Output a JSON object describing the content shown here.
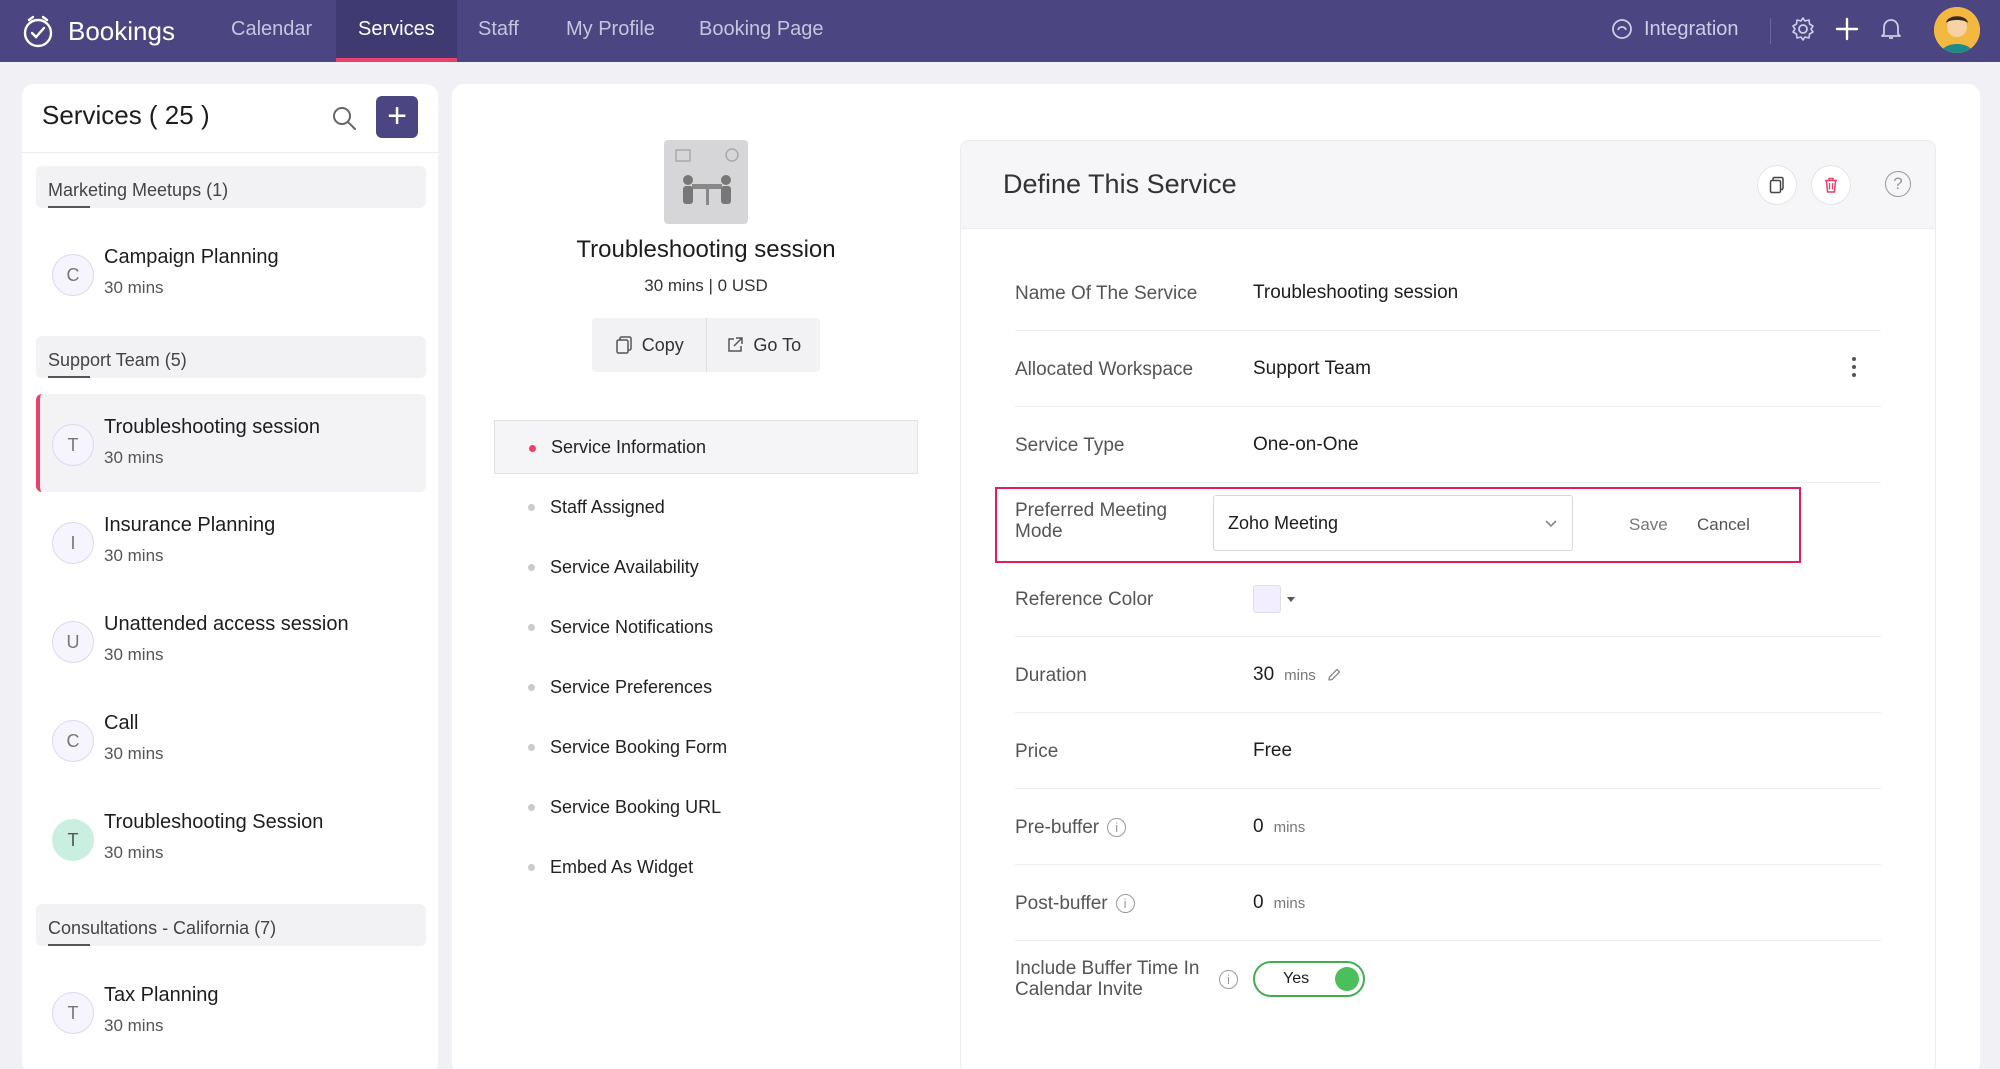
{
  "app": {
    "name": "Bookings"
  },
  "nav": {
    "tabs": [
      {
        "label": "Calendar"
      },
      {
        "label": "Services"
      },
      {
        "label": "Staff"
      },
      {
        "label": "My Profile"
      },
      {
        "label": "Booking Page"
      }
    ],
    "integration_label": "Integration"
  },
  "services_panel": {
    "title": "Services ( 25 )",
    "groups": [
      {
        "name": "Marketing Meetups (1)"
      },
      {
        "name": "Support Team (5)"
      },
      {
        "name": "Consultations - California (7)"
      }
    ],
    "items": [
      {
        "initial": "C",
        "name": "Campaign Planning",
        "duration": "30 mins"
      },
      {
        "initial": "T",
        "name": "Troubleshooting session",
        "duration": "30 mins"
      },
      {
        "initial": "I",
        "name": "Insurance Planning",
        "duration": "30 mins"
      },
      {
        "initial": "U",
        "name": "Unattended access session",
        "duration": "30 mins"
      },
      {
        "initial": "C",
        "name": "Call",
        "duration": "30 mins"
      },
      {
        "initial": "T",
        "name": "Troubleshooting Session",
        "duration": "30 mins"
      },
      {
        "initial": "T",
        "name": "Tax Planning",
        "duration": "30 mins"
      }
    ]
  },
  "service": {
    "title": "Troubleshooting session",
    "meta": "30 mins | 0 USD",
    "copy_label": "Copy",
    "goto_label": "Go To",
    "menu": [
      {
        "label": "Service Information"
      },
      {
        "label": "Staff Assigned"
      },
      {
        "label": "Service Availability"
      },
      {
        "label": "Service Notifications"
      },
      {
        "label": "Service Preferences"
      },
      {
        "label": "Service Booking Form"
      },
      {
        "label": "Service Booking URL"
      },
      {
        "label": "Embed As Widget"
      }
    ]
  },
  "define": {
    "title": "Define This Service",
    "help": "?",
    "fields": {
      "name": {
        "label": "Name Of The Service",
        "value": "Troubleshooting session"
      },
      "workspace": {
        "label": "Allocated Workspace",
        "value": "Support Team"
      },
      "type": {
        "label": "Service Type",
        "value": "One-on-One"
      },
      "meeting_mode": {
        "label": "Preferred Meeting Mode",
        "value": "Zoho Meeting",
        "save": "Save",
        "cancel": "Cancel"
      },
      "color": {
        "label": "Reference Color",
        "value": "#f3eefd"
      },
      "duration": {
        "label": "Duration",
        "value": "30",
        "unit": "mins"
      },
      "price": {
        "label": "Price",
        "value": "Free"
      },
      "pre_buffer": {
        "label": "Pre-buffer",
        "value": "0",
        "unit": "mins",
        "info": "i"
      },
      "post_buffer": {
        "label": "Post-buffer",
        "value": "0",
        "unit": "mins",
        "info": "i"
      },
      "include_buffer": {
        "label": "Include Buffer Time In Calendar Invite",
        "value": "Yes",
        "info": "i"
      }
    }
  },
  "colors": {
    "nav_bg": "#4b4581",
    "accent": "#e8416a",
    "toggle_on": "#4bbf5b",
    "highlight": "#e11d5b"
  }
}
